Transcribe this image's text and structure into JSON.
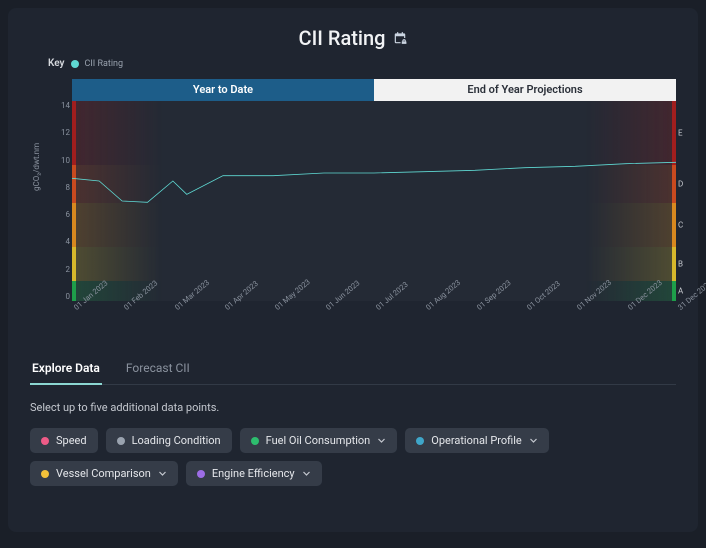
{
  "header": {
    "title": "CII Rating"
  },
  "legend": {
    "label": "Key",
    "series_name": "CII Rating",
    "series_color": "#5fd9d3"
  },
  "segmented": {
    "active": "Year to Date",
    "inactive": "End of Year Projections"
  },
  "chart_data": {
    "type": "line",
    "ylabel": "gCO₂/dwt.nm",
    "ylim": [
      0,
      15
    ],
    "y_ticks": [
      0,
      2,
      4,
      6,
      8,
      10,
      12,
      14
    ],
    "categories": [
      "01 Jan 2023",
      "01 Feb 2023",
      "01 Mar 2023",
      "01 Apr 2023",
      "01 May 2023",
      "01 Jun 2023",
      "01 Jul 2023",
      "01 Aug 2023",
      "01 Sep 2023",
      "01 Oct 2023",
      "01 Nov 2023",
      "01 Dec 2023",
      "31 Dec 2023"
    ],
    "x_points": [
      {
        "x": 0.0,
        "y": 9.2
      },
      {
        "x": 0.045,
        "y": 9.0
      },
      {
        "x": 0.083,
        "y": 7.5
      },
      {
        "x": 0.125,
        "y": 7.4
      },
      {
        "x": 0.167,
        "y": 9.0
      },
      {
        "x": 0.19,
        "y": 8.0
      },
      {
        "x": 0.25,
        "y": 9.4
      },
      {
        "x": 0.333,
        "y": 9.4
      },
      {
        "x": 0.417,
        "y": 9.6
      },
      {
        "x": 0.5,
        "y": 9.6
      },
      {
        "x": 0.583,
        "y": 9.7
      },
      {
        "x": 0.667,
        "y": 9.8
      },
      {
        "x": 0.75,
        "y": 10.0
      },
      {
        "x": 0.833,
        "y": 10.1
      },
      {
        "x": 0.917,
        "y": 10.3
      },
      {
        "x": 1.0,
        "y": 10.4
      }
    ],
    "grade_bands_right": [
      {
        "label": "E",
        "top": 0.0,
        "color": "#a11e1e"
      },
      {
        "label": "D",
        "top": 0.32,
        "color": "#c94a1f"
      },
      {
        "label": "C",
        "top": 0.51,
        "color": "#d8891f"
      },
      {
        "label": "B",
        "top": 0.73,
        "color": "#d7b82c"
      },
      {
        "label": "A",
        "top": 0.9,
        "color": "#1e9e4a"
      }
    ]
  },
  "tabs": {
    "active": "Explore Data",
    "inactive": "Forecast CII"
  },
  "instruction": "Select up to five additional data points.",
  "chips": [
    {
      "label": "Speed",
      "color": "#ee5b87",
      "dropdown": false
    },
    {
      "label": "Loading Condition",
      "color": "#9aa3af",
      "dropdown": false
    },
    {
      "label": "Fuel Oil Consumption",
      "color": "#2dbd6e",
      "dropdown": true
    },
    {
      "label": "Operational Profile",
      "color": "#3fa6c9",
      "dropdown": true
    },
    {
      "label": "Vessel Comparison",
      "color": "#f3c13a",
      "dropdown": true
    },
    {
      "label": "Engine Efficiency",
      "color": "#9d6de6",
      "dropdown": true
    }
  ]
}
